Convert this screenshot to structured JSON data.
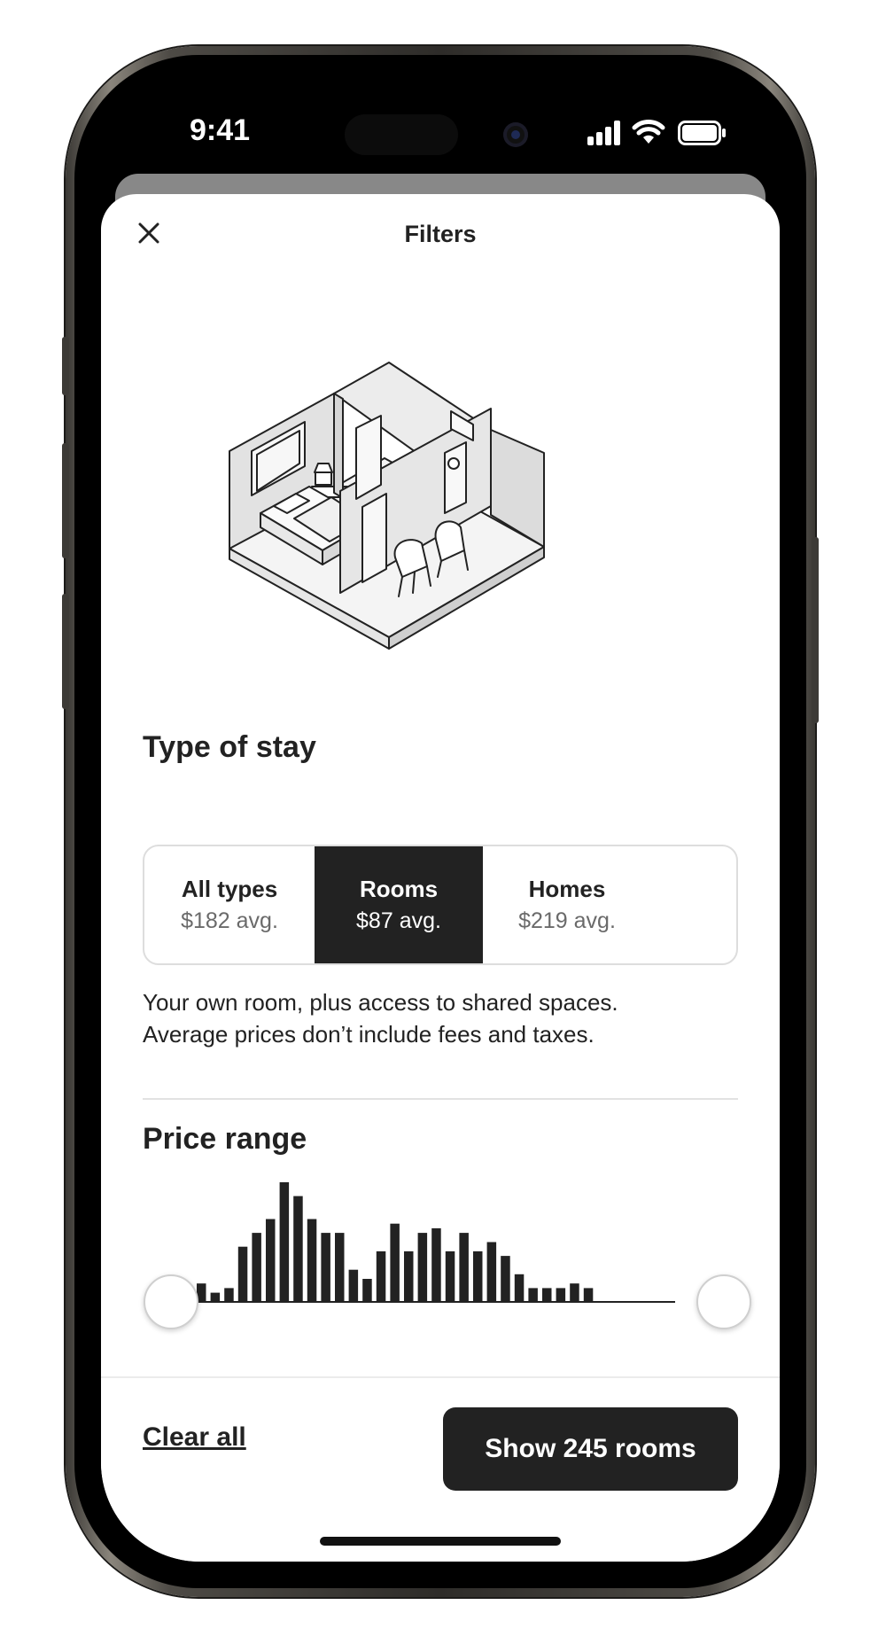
{
  "status_bar": {
    "time": "9:41"
  },
  "header": {
    "title": "Filters",
    "close_icon": "close-icon"
  },
  "type_of_stay": {
    "title": "Type of stay",
    "options": [
      {
        "label": "All types",
        "sub": "$182 avg.",
        "selected": false
      },
      {
        "label": "Rooms",
        "sub": "$87 avg.",
        "selected": true
      },
      {
        "label": "Homes",
        "sub": "$219 avg.",
        "selected": false
      }
    ],
    "description_line1": "Your own room, plus access to shared spaces.",
    "description_line2": "Average prices don’t include fees and taxes."
  },
  "price_range": {
    "title": "Price range",
    "histogram": [
      2,
      1,
      1.5,
      6,
      7.5,
      9,
      13,
      11.5,
      9,
      7.5,
      7.5,
      3.5,
      2.5,
      5.5,
      8.5,
      5.5,
      7.5,
      8,
      5.5,
      7.5,
      5.5,
      6.5,
      5,
      3,
      1.5,
      1.5,
      1.5,
      2,
      1.5
    ]
  },
  "footer": {
    "clear_label": "Clear all",
    "show_label": "Show 245 rooms"
  },
  "colors": {
    "ink": "#222222",
    "muted": "#6a6a6a",
    "border": "#dddddd",
    "selected_bg": "#222222"
  }
}
